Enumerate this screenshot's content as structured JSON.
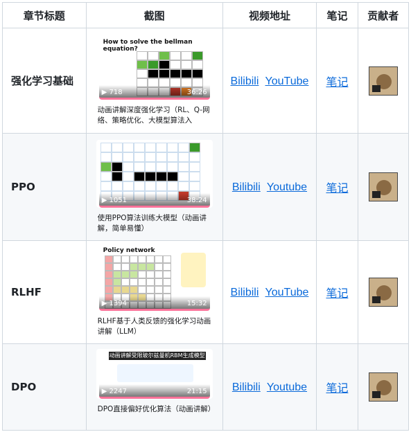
{
  "headers": {
    "chapter": "章节标题",
    "screenshot": "截图",
    "video": "视频地址",
    "notes": "笔记",
    "contributor": "贡献者"
  },
  "rows": [
    {
      "title": "强化学习基础",
      "thumb_title": "How to solve the bellman equation?",
      "plays": "718",
      "duration": "36:26",
      "caption": "动画讲解深度强化学习（RL、Q-网络、策略优化、大模型算法入",
      "link1": "Bilibili",
      "link2": "YouTube",
      "notes": "笔记",
      "avatar": "contributor-avatar"
    },
    {
      "title": "PPO",
      "thumb_title": "",
      "plays": "1051",
      "duration": "38:24",
      "caption": "使用PPO算法训练大模型（动画讲解，简单易懂）",
      "link1": "Bilibili",
      "link2": "Youtube",
      "notes": "笔记",
      "avatar": "contributor-avatar"
    },
    {
      "title": "RLHF",
      "thumb_title": "Policy network",
      "plays": "1394",
      "duration": "15:32",
      "caption": "RLHF基于人类反馈的强化学习动画讲解（LLM）",
      "link1": "Bilibili",
      "link2": "YouTube",
      "notes": "笔记",
      "avatar": "contributor-avatar"
    },
    {
      "title": "DPO",
      "thumb_title": "动画讲解受限玻尔兹曼机RBM生成模型",
      "plays": "2247",
      "duration": "21:15",
      "caption": "DPO直接偏好优化算法（动画讲解）",
      "link1": "Bilibili",
      "link2": "Youtube",
      "notes": "笔记",
      "avatar": "contributor-avatar"
    }
  ],
  "colors": {
    "link": "#0969da",
    "border": "#d0d7de",
    "stripe": "#f6f8fa",
    "progress": "#fb7299"
  }
}
